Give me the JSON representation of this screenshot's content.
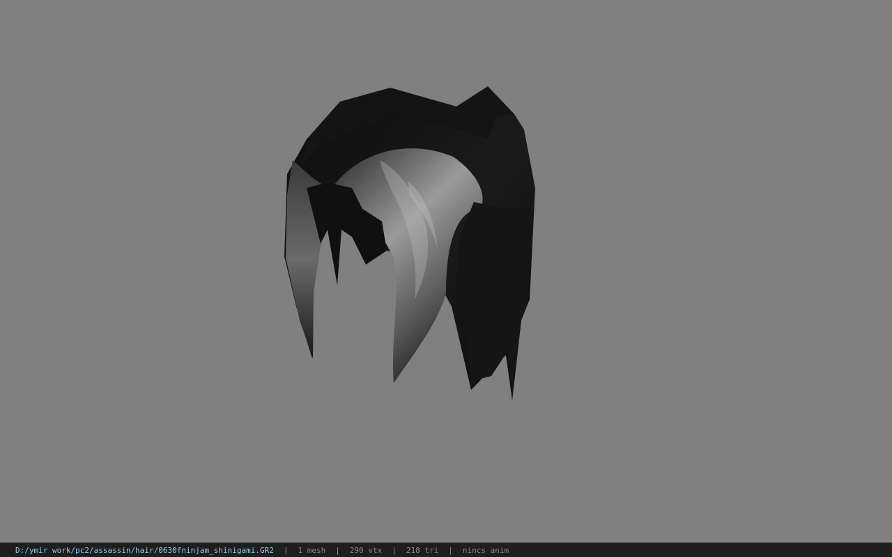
{
  "viewer": {
    "background_color": "#808080",
    "model": {
      "icon": "hair-mesh-model",
      "color": "#1a1a1a"
    }
  },
  "status_bar": {
    "file_path": "D:/ymir work/pc2/assassin/hair/0630fninjam_shinigami.GR2",
    "separator": "|",
    "mesh_count": "1 mesh",
    "vertex_count": "290 vtx",
    "triangle_count": "218 tri",
    "anim_status": "nincs anim",
    "path_color": "#8fd0e8",
    "text_color": "#8a8a8a",
    "background_color": "#1e1e1e"
  }
}
